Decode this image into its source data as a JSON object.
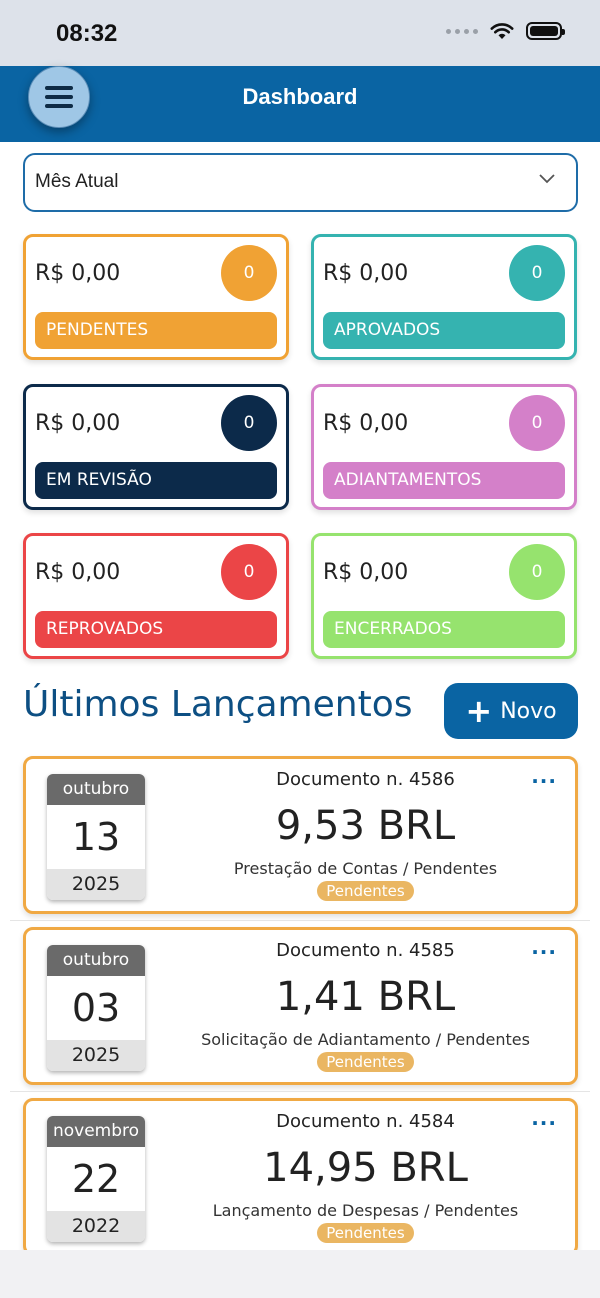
{
  "status_bar": {
    "time": "08:32"
  },
  "header": {
    "title": "Dashboard"
  },
  "period_select": {
    "value": "Mês Atual"
  },
  "summary_cards": [
    {
      "amount": "R$ 0,00",
      "count": "0",
      "label": "PENDENTES",
      "color": "#f0a234"
    },
    {
      "amount": "R$ 0,00",
      "count": "0",
      "label": "APROVADOS",
      "color": "#35b3b0"
    },
    {
      "amount": "R$ 0,00",
      "count": "0",
      "label": "EM REVISÃO",
      "color": "#0c2a4a"
    },
    {
      "amount": "R$ 0,00",
      "count": "0",
      "label": "ADIANTAMENTOS",
      "color": "#d480c9"
    },
    {
      "amount": "R$ 0,00",
      "count": "0",
      "label": "REPROVADOS",
      "color": "#eb4547"
    },
    {
      "amount": "R$ 0,00",
      "count": "0",
      "label": "ENCERRADOS",
      "color": "#96e36e"
    }
  ],
  "section": {
    "title": "Últimos Lançamentos",
    "new_button": "Novo"
  },
  "entries": [
    {
      "month": "outubro",
      "day": "13",
      "year": "2025",
      "document": "Documento n. 4586",
      "value": "9,53 BRL",
      "description": "Prestação de Contas / Pendentes",
      "status": "Pendentes",
      "more": "···"
    },
    {
      "month": "outubro",
      "day": "03",
      "year": "2025",
      "document": "Documento n. 4585",
      "value": "1,41 BRL",
      "description": "Solicitação de Adiantamento / Pendentes",
      "status": "Pendentes",
      "more": "···"
    },
    {
      "month": "novembro",
      "day": "22",
      "year": "2022",
      "document": "Documento n. 4584",
      "value": "14,95 BRL",
      "description": "Lançamento de Despesas / Pendentes",
      "status": "Pendentes",
      "more": "···"
    }
  ],
  "icons": {
    "menu": "hamburger-icon",
    "wifi": "wifi-icon",
    "battery": "battery-icon",
    "signal": "signal-dots-icon",
    "chevron": "chevron-down-icon",
    "plus": "plus-icon",
    "more": "more-horizontal-icon"
  },
  "colors": {
    "brand": "#0a64a3",
    "header_title": "#0d4f83",
    "pending_badge": "#eab662"
  }
}
